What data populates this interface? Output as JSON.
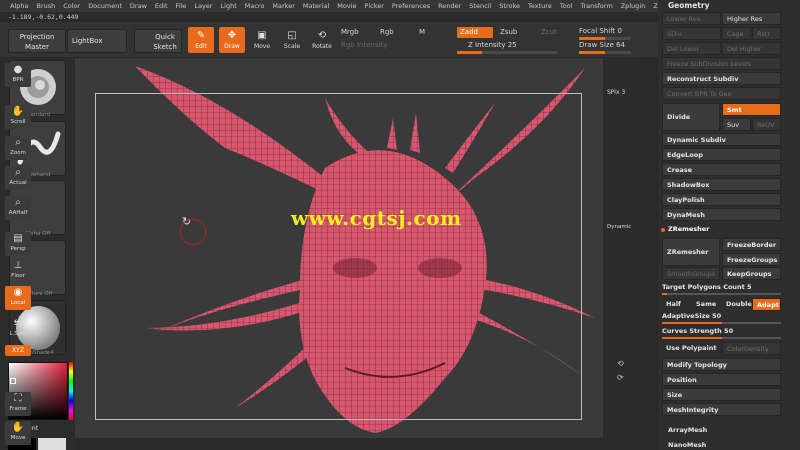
{
  "menu": [
    "Alpha",
    "Brush",
    "Color",
    "Document",
    "Draw",
    "Edit",
    "File",
    "Layer",
    "Light",
    "Macro",
    "Marker",
    "Material",
    "Movie",
    "Picker",
    "Preferences",
    "Render",
    "Stencil",
    "Stroke",
    "Texture",
    "Tool",
    "Transform",
    "Zplugin",
    "Zscript"
  ],
  "coords": "-1.189,-0.62,0.449",
  "shelf": {
    "projection_master": "Projection Master",
    "lightbox": "LightBox",
    "quick_sketch": "Quick Sketch",
    "edit": "Edit",
    "draw": "Draw",
    "move": "Move",
    "scale": "Scale",
    "rotate": "Rotate",
    "mrgb": "Mrgb",
    "rgb": "Rgb",
    "m": "M",
    "rgb_intensity": "Rgb Intensity",
    "zadd": "Zadd",
    "zsub": "Zsub",
    "zcut": "Zcut",
    "z_intensity": "Z Intensity 25",
    "focal_shift": "Focal Shift 0",
    "draw_size": "Draw Size 64"
  },
  "left": {
    "brush1": "Standard",
    "brush2": "Freehand",
    "alpha": "Alpha Off",
    "texture": "Texture Off",
    "material": "SkinShade4",
    "gradient": "Gradient"
  },
  "right_strip": {
    "bpr": "BPR",
    "spix": "SPix 3",
    "scroll": "Scroll",
    "zoom": "Zoom",
    "actual": "Actual",
    "aahalf": "AAHalf",
    "dynamic": "Dynamic",
    "persp": "Persp",
    "floor": "Floor",
    "local": "Local",
    "lsym": "L.Sym",
    "xyz": "XYZ",
    "frame": "Frame",
    "move": "Move"
  },
  "palette": {
    "title": "Geometry",
    "lower_res": "Lower Res",
    "higher_res": "Higher Res",
    "sdiv": "SDiv",
    "cage": "Cage",
    "rstr": "Rstr",
    "del_lower": "Del Lower",
    "del_higher": "Del Higher",
    "freeze": "Freeze SubDivision Levels",
    "reconstruct": "Reconstruct Subdiv",
    "convert": "Convert BPR To Geo",
    "divide": "Divide",
    "smt": "Smt",
    "suv": "Suv",
    "reuv": "ReUV",
    "dynamic_subdiv": "Dynamic Subdiv",
    "edgeloop": "EdgeLoop",
    "crease": "Crease",
    "shadowbox": "ShadowBox",
    "claypolish": "ClayPolish",
    "dynamesh": "DynaMesh",
    "zremesher_header": "ZRemesher",
    "zremesher_btn": "ZRemesher",
    "freeze_border": "FreezeBorder",
    "freeze_groups": "FreezeGroups",
    "smooth_groups": "SmoothGroups",
    "keep_groups": "KeepGroups",
    "target_polys": "Target Polygons Count 5",
    "half": "Half",
    "same": "Same",
    "double": "Double",
    "adapt": "Adapt",
    "adaptive_size": "AdaptiveSize 50",
    "curves_strength": "Curves Strength 50",
    "use_polypaint": "Use Polypaint",
    "color_density": "ColorDensity",
    "modify_topology": "Modify Topology",
    "position": "Position",
    "size": "Size",
    "mesh_integrity": "MeshIntegrity",
    "arraymesh": "ArrayMesh",
    "nanomesh": "NanoMesh"
  },
  "watermark": "www.cgtsj.com",
  "colors": {
    "accent": "#e86a1b",
    "mesh": "#d8576f",
    "watermark": "#f2ee1e"
  },
  "sliders": {
    "z_intensity": 0.25,
    "draw_size": 0.5,
    "focal_shift": 0.5,
    "adaptive_size": 0.5,
    "curves_strength": 0.5
  }
}
